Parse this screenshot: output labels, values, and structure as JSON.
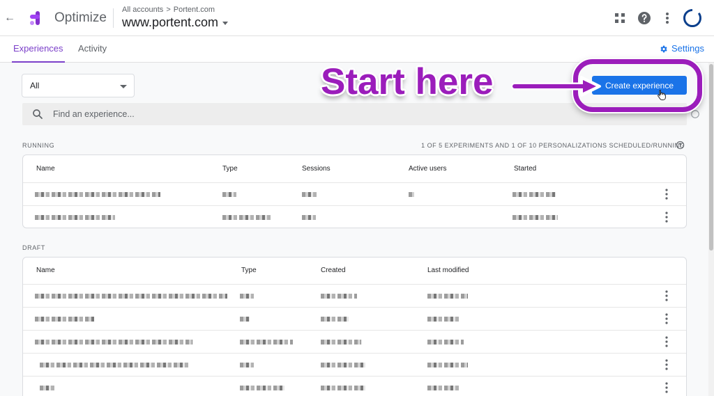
{
  "header": {
    "app_name": "Optimize",
    "breadcrumb": [
      "All accounts",
      "Portent.com"
    ],
    "breadcrumb_separator": ">",
    "property": "www.portent.com",
    "icons": [
      "back-arrow-icon",
      "optimize-logo-icon",
      "apps-grid-icon",
      "help-icon",
      "more-vert-icon",
      "account-avatar-icon"
    ]
  },
  "tabs": [
    {
      "label": "Experiences",
      "active": true
    },
    {
      "label": "Activity",
      "active": false
    }
  ],
  "settings_label": "Settings",
  "filter": {
    "selected": "All"
  },
  "create_button_label": "Create experience",
  "search": {
    "placeholder": "Find an experience..."
  },
  "running": {
    "label": "RUNNING",
    "summary": "1 OF 5 EXPERIMENTS AND 1 OF 10 PERSONALIZATIONS SCHEDULED/RUNNING",
    "columns": [
      "Name",
      "Type",
      "Sessions",
      "Active users",
      "Started"
    ],
    "rows": 2
  },
  "draft": {
    "label": "DRAFT",
    "columns": [
      "Name",
      "Type",
      "Created",
      "Last modified"
    ],
    "rows": 5
  },
  "annotation": {
    "text": "Start here"
  },
  "colors": {
    "accent_purple": "#7b3fc9",
    "annotation_purple": "#9b1dbb",
    "primary_blue": "#1a73e8"
  }
}
